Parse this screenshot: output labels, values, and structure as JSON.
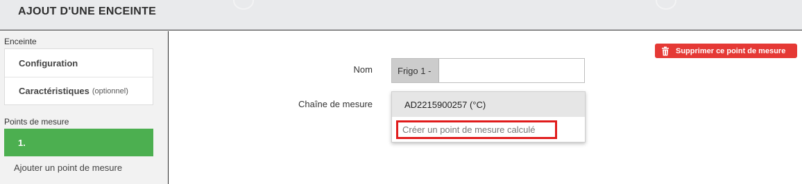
{
  "modal": {
    "title": "AJOUT D'UNE ENCEINTE"
  },
  "sidebar": {
    "enceinte_label": "Enceinte",
    "items": [
      {
        "label": "Configuration",
        "optional": ""
      },
      {
        "label": "Caractéristiques",
        "optional": "(optionnel)"
      }
    ],
    "points_label": "Points de mesure",
    "active_point": "1.",
    "add_point": "Ajouter un point de mesure"
  },
  "form": {
    "nom_label": "Nom",
    "nom_prefix": "Frigo 1 -",
    "nom_value": "",
    "chaine_label": "Chaîne de mesure",
    "dropdown": {
      "selected": "AD2215900257 (°C)",
      "create_option": "Créer un point de mesure calculé"
    }
  },
  "actions": {
    "delete_label": "Supprimer ce point de mesure"
  },
  "colors": {
    "active_green": "#4caf50",
    "delete_red": "#e53935",
    "highlight_red": "#e01b1b"
  }
}
